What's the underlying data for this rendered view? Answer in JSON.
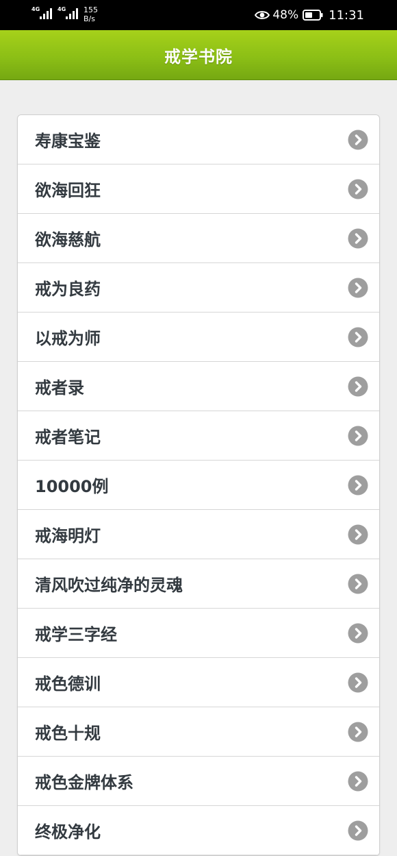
{
  "status_bar": {
    "signal1_label": "4G",
    "signal2_label": "4G",
    "net_speed_value": "155",
    "net_speed_unit": "B/s",
    "battery_percent": "48%",
    "time": "11:31"
  },
  "header": {
    "title": "戒学书院"
  },
  "list": {
    "items": [
      {
        "label": "寿康宝鉴"
      },
      {
        "label": "欲海回狂"
      },
      {
        "label": "欲海慈航"
      },
      {
        "label": "戒为良药"
      },
      {
        "label": "以戒为师"
      },
      {
        "label": "戒者录"
      },
      {
        "label": "戒者笔记"
      },
      {
        "label": "10000例"
      },
      {
        "label": "戒海明灯"
      },
      {
        "label": "清风吹过纯净的灵魂"
      },
      {
        "label": "戒学三字经"
      },
      {
        "label": "戒色德训"
      },
      {
        "label": "戒色十规"
      },
      {
        "label": "戒色金牌体系"
      },
      {
        "label": "终极净化"
      }
    ]
  },
  "colors": {
    "header_top": "#a6d11a",
    "header_bottom": "#75a812",
    "background": "#eeeeee",
    "chevron": "#9e9e9e",
    "label_text": "#333a40"
  }
}
